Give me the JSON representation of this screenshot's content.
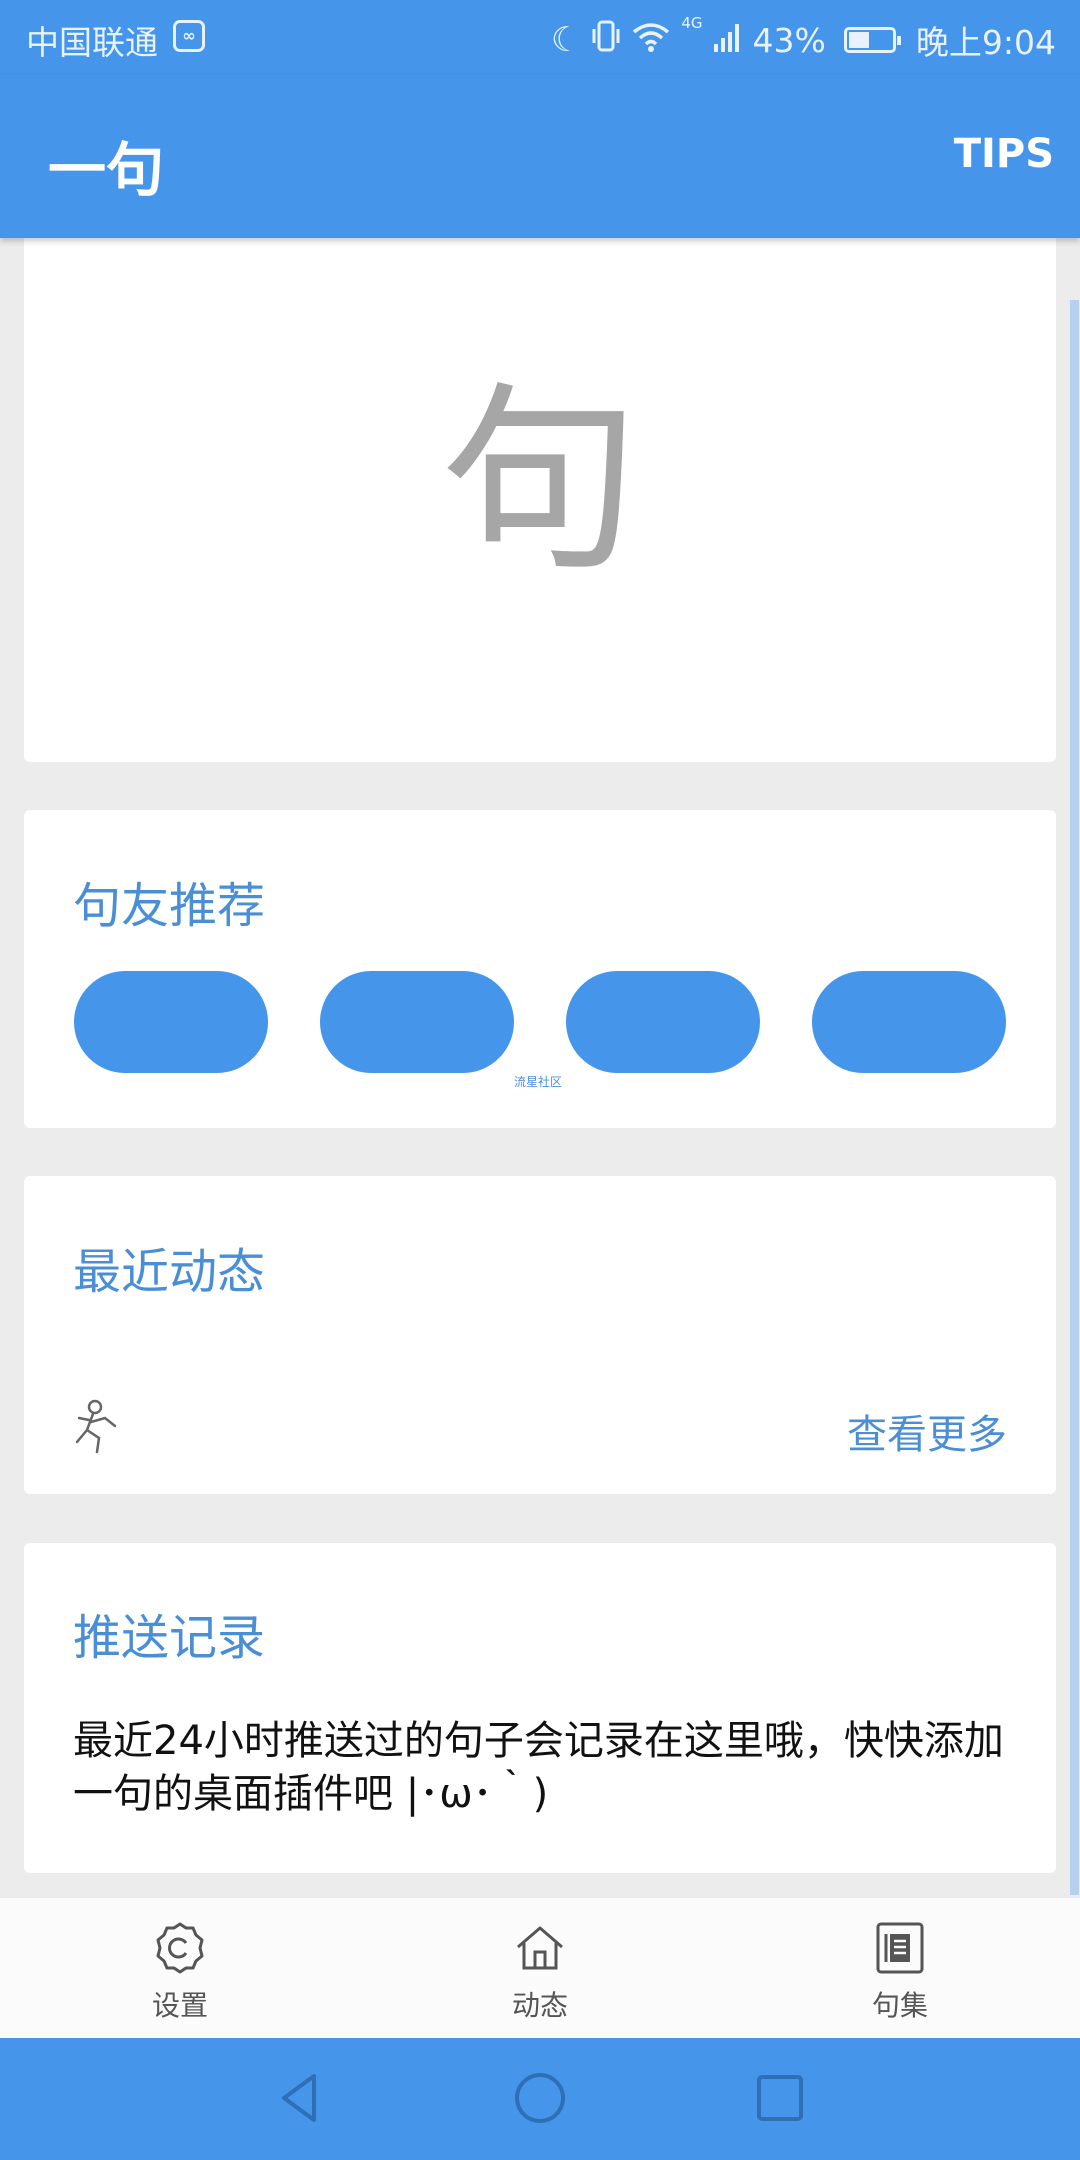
{
  "status_bar": {
    "carrier": "中国联通",
    "carrier_badge": "∞",
    "battery_text": "43%",
    "battery_level": 0.43,
    "time": "晚上9:04",
    "network": "4G",
    "icons": [
      "moon-icon",
      "vibrate-icon",
      "wifi-icon",
      "signal-icon",
      "battery-icon"
    ]
  },
  "app_bar": {
    "title": "一句",
    "tips_label": "TIPS"
  },
  "hero": {
    "glyph": "句"
  },
  "friends": {
    "title": "句友推荐",
    "watermark": "流星社区"
  },
  "activity": {
    "title": "最近动态",
    "see_more": "查看更多"
  },
  "push_records": {
    "title": "推送记录",
    "text": "最近24小时推送过的句子会记录在这里哦，快快添加一句的桌面插件吧 |･ω･｀)"
  },
  "bottom_nav": {
    "items": [
      {
        "label": "设置",
        "icon": "settings-icon"
      },
      {
        "label": "动态",
        "icon": "home-icon"
      },
      {
        "label": "句集",
        "icon": "notebook-icon"
      }
    ]
  },
  "colors": {
    "primary": "#4596ea",
    "accent_text": "#4a8fd6",
    "background": "#ececec"
  }
}
